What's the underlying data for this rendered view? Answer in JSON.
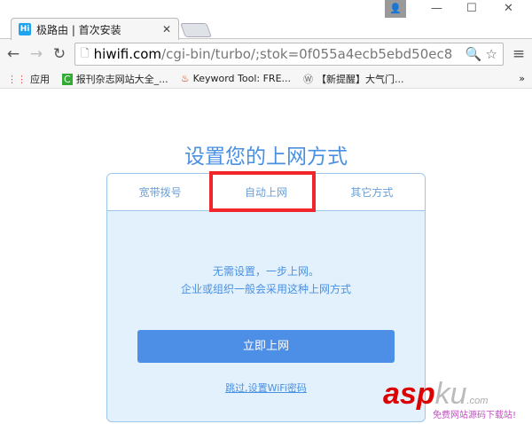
{
  "browser": {
    "tab_title": "极路由 | 首次安装",
    "favicon": "Hi",
    "url_host": "hiwifi.com",
    "url_path": "/cgi-bin/turbo/;stok=0f055a4ecb5ebd50ec8",
    "bookmarks": [
      "应用",
      "报刊杂志网站大全_...",
      "Keyword Tool: FRE...",
      "【新提醒】大气门..."
    ],
    "more": "»"
  },
  "page": {
    "title": "设置您的上网方式",
    "tabs": [
      "宽带拨号",
      "自动上网",
      "其它方式"
    ],
    "selected_tab": "自动上网",
    "message_line1": "无需设置，一步上网。",
    "message_line2": "企业或组织一般会采用这种上网方式",
    "connect_button": "立即上网",
    "skip_link": "跳过,设置WiFi密码"
  },
  "watermark": {
    "brand_a": "asp",
    "brand_b": "ku",
    ".com": ".com",
    "slogan": "免费网站源码下载站!"
  }
}
